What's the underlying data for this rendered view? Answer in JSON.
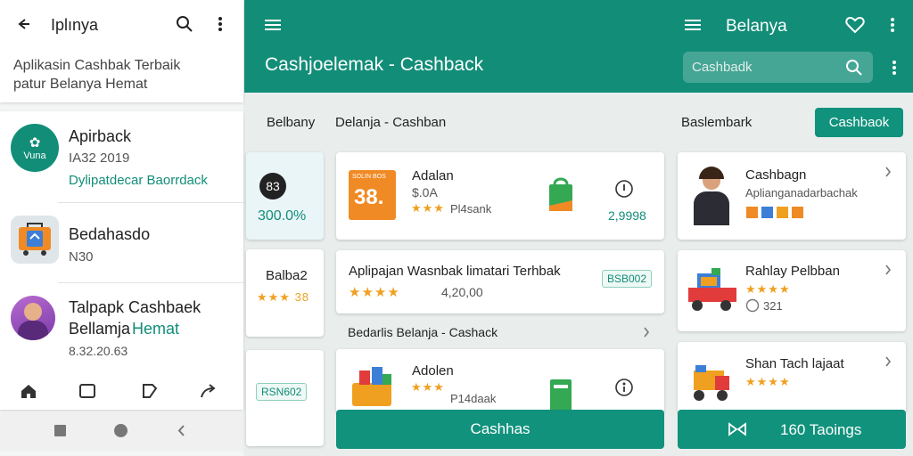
{
  "left_phone": {
    "header_title": "Iplınya",
    "subtitle": "Aplikasin Cashbak Terbaik patur Belanya Hemat",
    "items": [
      {
        "title": "Apirback",
        "sub": "IA32 2019",
        "link": "Dylipatdecar Baorrdack",
        "icon_text": "Vuna"
      },
      {
        "title": "Bedahasdo",
        "sub": "N30"
      },
      {
        "title": "Talpapk Cashbaek",
        "title2a": "Bellamja",
        "title2b": "Hemat",
        "sub": "8.32.20.63"
      }
    ]
  },
  "main": {
    "header_title": "Cashjoelemak - Cashback",
    "search_placeholder": "Cashbadk",
    "right_title": "Belanya",
    "section_left": "Belbany",
    "section_mid": "Delanja - Cashban",
    "section_right": "Baslembark",
    "cashback_chip": "Cashbaok",
    "side_number": "83",
    "side_percent": "300.0%",
    "side_label": "Balba2",
    "side_rating": "★★★ 38",
    "side_badge": "RSN602",
    "card1": {
      "thumb": "38.",
      "thumb_top": "SOLIN BOS",
      "title": "Adalan",
      "price": "$.0A",
      "stars": "★★★",
      "sub": "Pl4sank",
      "value": "2,9998"
    },
    "card2": {
      "title": "Aplipajan Wasnbak limatari Terhbak",
      "stars": "★★★★",
      "rating": "4,20,00",
      "badge": "BSB002"
    },
    "section_row": "Bedarlis Belanja - Cashack",
    "card3": {
      "title": "Adolen",
      "stars": "★★★",
      "sub": "P14daak"
    },
    "btn_main": "Cashhas",
    "right_cards": [
      {
        "title": "Cashbagn",
        "sub": "Aplianganadarbachak"
      },
      {
        "title": "Rahlay Pelbban",
        "stars": "★★★★",
        "rating": "321"
      },
      {
        "title": "Shan Tach lajaat",
        "stars": "★★★★"
      }
    ],
    "btn_right": "160 Taoings"
  },
  "colors": {
    "accent": "#128d78",
    "star": "#f0a020",
    "orange": "#f08a24"
  }
}
